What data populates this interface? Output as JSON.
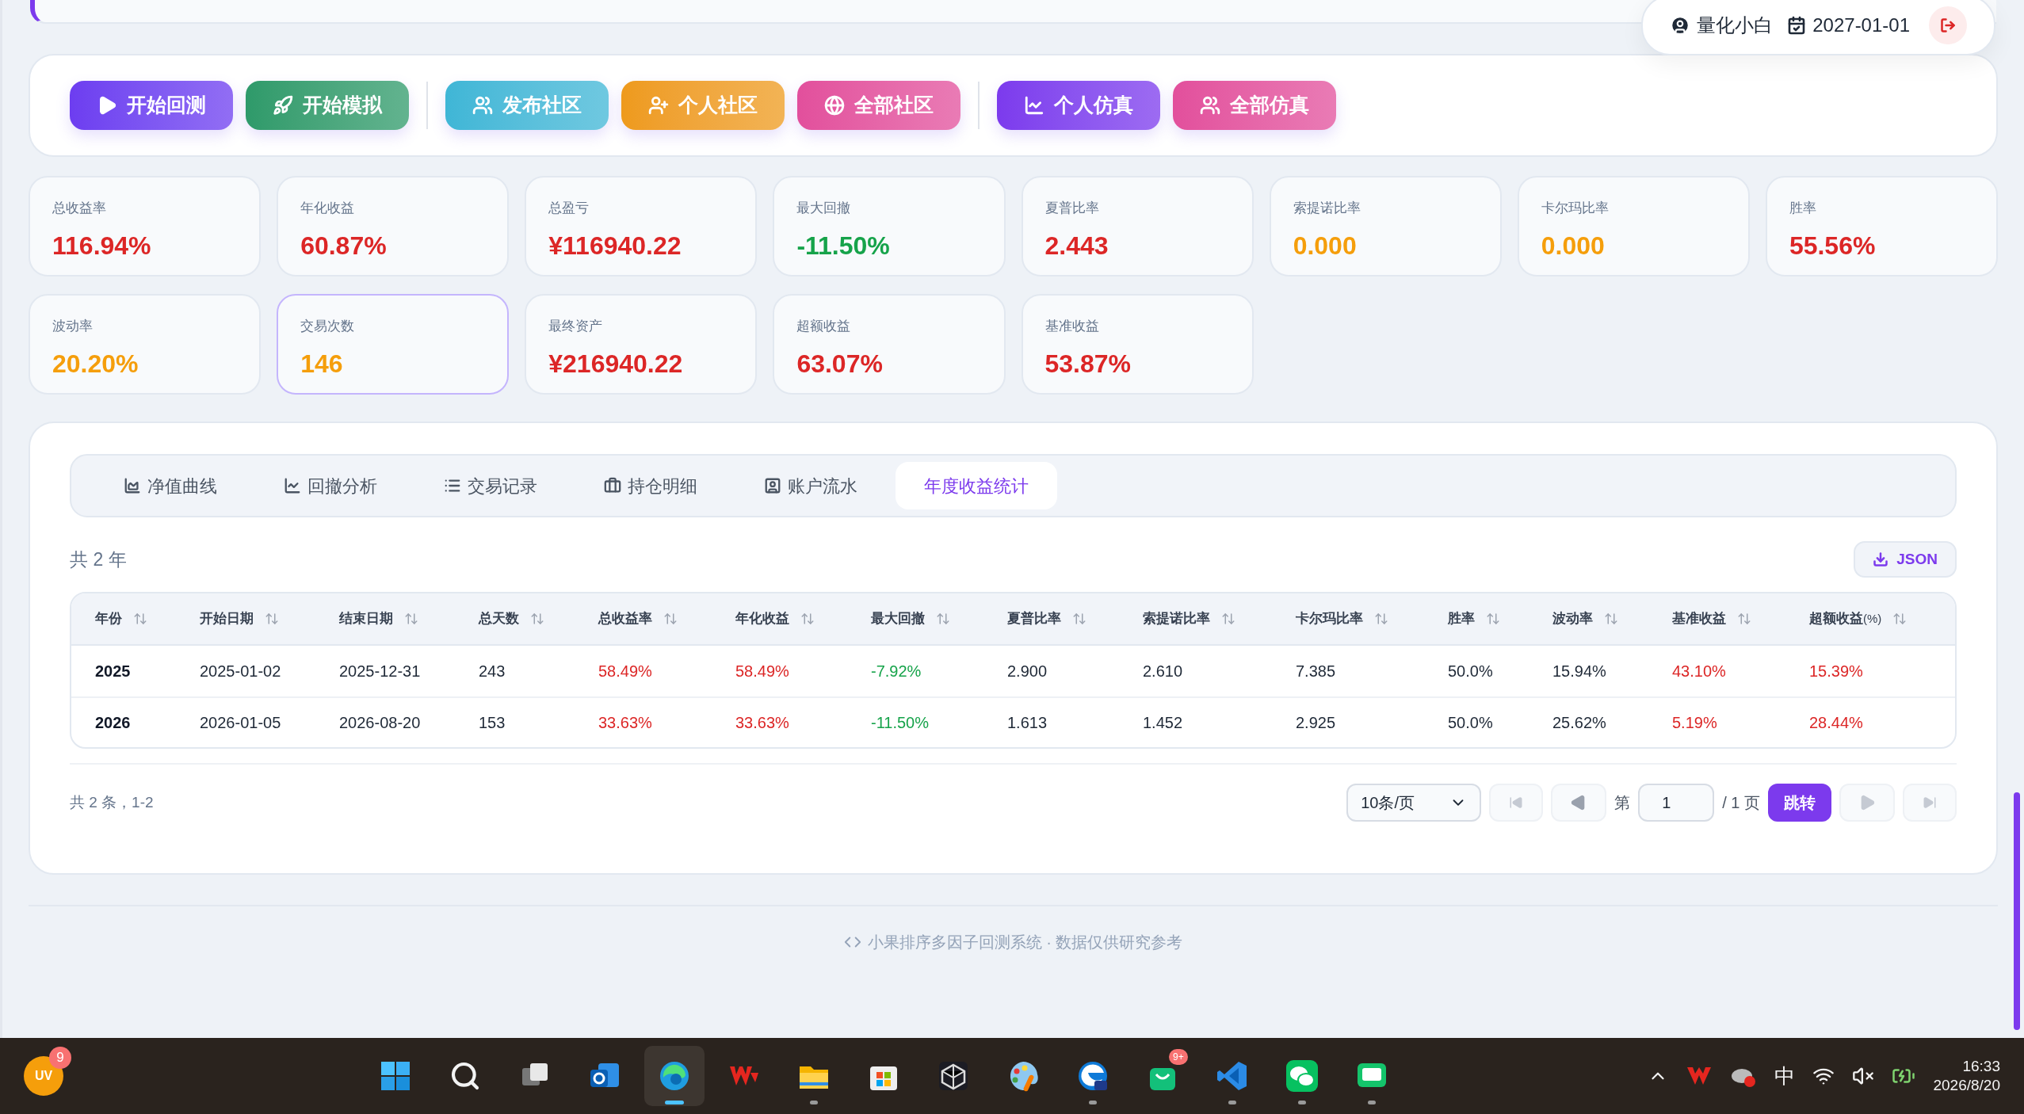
{
  "user_bar": {
    "username": "量化小白",
    "date": "2027-01-01"
  },
  "actions": [
    {
      "label": "开始回测",
      "kind": "play",
      "color": "#6d3df0"
    },
    {
      "label": "开始模拟",
      "kind": "rocket",
      "color": "#2e9a6a"
    },
    {
      "label": "发布社区",
      "kind": "users",
      "color": "#3fb6d6"
    },
    {
      "label": "个人社区",
      "kind": "adduser",
      "color": "#ee9a1c"
    },
    {
      "label": "全部社区",
      "kind": "globe",
      "color": "#e24f9c"
    },
    {
      "label": "个人仿真",
      "kind": "chart",
      "color": "#7c3aed"
    },
    {
      "label": "全部仿真",
      "kind": "users",
      "color": "#e24f9c"
    }
  ],
  "metrics": [
    {
      "label": "总收益率",
      "value": "116.94%",
      "color": "#dc2626",
      "selected": false
    },
    {
      "label": "年化收益",
      "value": "60.87%",
      "color": "#dc2626",
      "selected": false
    },
    {
      "label": "总盈亏",
      "value": "¥116940.22",
      "color": "#dc2626",
      "selected": false
    },
    {
      "label": "最大回撤",
      "value": "-11.50%",
      "color": "#16a34a",
      "selected": false
    },
    {
      "label": "夏普比率",
      "value": "2.443",
      "color": "#dc2626",
      "selected": false
    },
    {
      "label": "索提诺比率",
      "value": "0.000",
      "color": "#f59e0b",
      "selected": false
    },
    {
      "label": "卡尔玛比率",
      "value": "0.000",
      "color": "#f59e0b",
      "selected": false
    },
    {
      "label": "胜率",
      "value": "55.56%",
      "color": "#dc2626",
      "selected": false
    },
    {
      "label": "波动率",
      "value": "20.20%",
      "color": "#f59e0b",
      "selected": false
    },
    {
      "label": "交易次数",
      "value": "146",
      "color": "#f59e0b",
      "selected": true
    },
    {
      "label": "最终资产",
      "value": "¥216940.22",
      "color": "#dc2626",
      "selected": false
    },
    {
      "label": "超额收益",
      "value": "63.07%",
      "color": "#dc2626",
      "selected": false
    },
    {
      "label": "基准收益",
      "value": "53.87%",
      "color": "#dc2626",
      "selected": false
    }
  ],
  "tabs": [
    {
      "label": "净值曲线",
      "kind": "area",
      "selected": false
    },
    {
      "label": "回撤分析",
      "kind": "line",
      "selected": false
    },
    {
      "label": "交易记录",
      "kind": "list",
      "selected": false
    },
    {
      "label": "持仓明细",
      "kind": "briefcase",
      "selected": false
    },
    {
      "label": "账户流水",
      "kind": "contact",
      "selected": false
    },
    {
      "label": "年度收益统计",
      "kind": "plain",
      "selected": true
    }
  ],
  "summary": "共 2 年",
  "export_button": "JSON",
  "table": {
    "columns": [
      {
        "label": "年份",
        "kind": "key",
        "color": "#111827"
      },
      {
        "label": "开始日期",
        "kind": "plain",
        "color": "#1f2937"
      },
      {
        "label": "结束日期",
        "kind": "plain",
        "color": "#1f2937"
      },
      {
        "label": "总天数",
        "kind": "plain",
        "color": "#1f2937"
      },
      {
        "label": "总收益率",
        "kind": "plain",
        "color": "#dc2626"
      },
      {
        "label": "年化收益",
        "kind": "plain",
        "color": "#dc2626"
      },
      {
        "label": "最大回撤",
        "kind": "plain",
        "color": "#16a34a"
      },
      {
        "label": "夏普比率",
        "kind": "plain",
        "color": "#1f2937"
      },
      {
        "label": "索提诺比率",
        "kind": "plain",
        "color": "#1f2937"
      },
      {
        "label": "卡尔玛比率",
        "kind": "plain",
        "color": "#1f2937"
      },
      {
        "label": "胜率",
        "kind": "plain",
        "color": "#1f2937"
      },
      {
        "label": "波动率",
        "kind": "plain",
        "color": "#1f2937"
      },
      {
        "label": "基准收益",
        "kind": "plain",
        "color": "#dc2626"
      },
      {
        "label": "超额收益",
        "unit": "(%)",
        "kind": "plain",
        "color": "#dc2626"
      }
    ],
    "rows": [
      [
        "2025",
        "2025-01-02",
        "2025-12-31",
        "243",
        "58.49%",
        "58.49%",
        "-7.92%",
        "2.900",
        "2.610",
        "7.385",
        "50.0%",
        "15.94%",
        "43.10%",
        "15.39%"
      ],
      [
        "2026",
        "2026-01-05",
        "2026-08-20",
        "153",
        "33.63%",
        "33.63%",
        "-11.50%",
        "1.613",
        "1.452",
        "2.925",
        "50.0%",
        "25.62%",
        "5.19%",
        "28.44%"
      ]
    ]
  },
  "pagination": {
    "info": "共 2 条，1-2",
    "page_size": "10条/页",
    "page_prefix": "第",
    "page": "1",
    "page_suffix": "/ 1 页",
    "jump": "跳转"
  },
  "footer": "小果排序多因子回测系统 · 数据仅供研究参考",
  "taskbar": {
    "avatar": "UV",
    "avatar_badge": "9",
    "apps": [
      {
        "kind": "start",
        "running": false,
        "selected": false
      },
      {
        "kind": "search",
        "running": false,
        "selected": false
      },
      {
        "kind": "taskview",
        "running": false,
        "selected": false
      },
      {
        "kind": "mail",
        "running": false,
        "selected": false
      },
      {
        "kind": "browser",
        "running": true,
        "selected": true
      },
      {
        "kind": "wps",
        "running": false,
        "selected": false
      },
      {
        "kind": "folder",
        "running": true,
        "selected": false
      },
      {
        "kind": "store",
        "running": false,
        "selected": false
      },
      {
        "kind": "cube",
        "running": false,
        "selected": false
      },
      {
        "kind": "paint",
        "running": false,
        "selected": false
      },
      {
        "kind": "browser2",
        "running": true,
        "selected": false
      },
      {
        "kind": "bag",
        "running": false,
        "selected": false,
        "badge": "9+"
      },
      {
        "kind": "code",
        "running": true,
        "selected": false
      },
      {
        "kind": "chat",
        "running": true,
        "selected": false
      },
      {
        "kind": "message",
        "running": true,
        "selected": false
      }
    ],
    "ime": "中",
    "time": "16:33",
    "date": "2026/8/20"
  }
}
